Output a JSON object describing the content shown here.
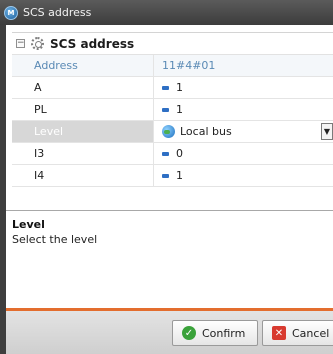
{
  "window": {
    "title": "SCS address",
    "app_icon": "app-icon"
  },
  "group": {
    "title": "SCS address",
    "icon": "gear-icon"
  },
  "header_row": {
    "name": "Address",
    "value": "11#4#01"
  },
  "rows": [
    {
      "name": "A",
      "value": "1",
      "icon": "blue-bar-icon"
    },
    {
      "name": "PL",
      "value": "1",
      "icon": "blue-bar-icon"
    },
    {
      "name": "Level",
      "value": "Local bus",
      "icon": "globe-icon",
      "selected": true
    },
    {
      "name": "I3",
      "value": "0",
      "icon": "blue-bar-icon"
    },
    {
      "name": "I4",
      "value": "1",
      "icon": "blue-bar-icon"
    }
  ],
  "description": {
    "title": "Level",
    "text": "Select the level"
  },
  "buttons": {
    "confirm": "Confirm",
    "cancel": "Cancel"
  },
  "colors": {
    "accent_line": "#e36d2e",
    "title_bar": "#4a4a4a",
    "selected_row": "#d7d7d7"
  }
}
